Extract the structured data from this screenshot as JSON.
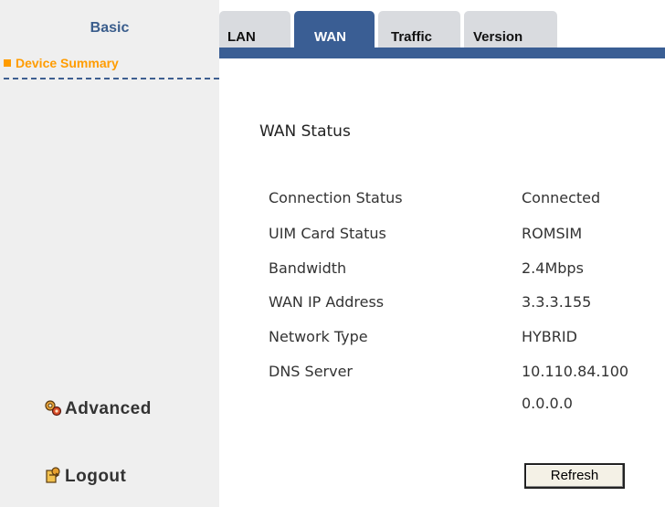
{
  "sidebar": {
    "basic_label": "Basic",
    "device_summary_label": "Device Summary",
    "advanced_label": "Advanced",
    "logout_label": "Logout",
    "accent_color": "#ff9c00",
    "icons": {
      "advanced": "gears-icon",
      "logout": "logout-icon"
    }
  },
  "tabs": [
    {
      "label": "LAN",
      "active": false
    },
    {
      "label": "WAN",
      "active": true
    },
    {
      "label": "Traffic",
      "active": false
    },
    {
      "label": "Version",
      "active": false
    }
  ],
  "theme": {
    "tab_active_color": "#3a5e94",
    "tab_inactive_color": "#d9dbdf"
  },
  "wan": {
    "title": "WAN Status",
    "rows": [
      {
        "label": "Connection Status",
        "value": "Connected"
      },
      {
        "label": "UIM Card Status",
        "value": "ROMSIM"
      },
      {
        "label": "Bandwidth",
        "value": "2.4Mbps"
      },
      {
        "label": "WAN IP Address",
        "value": "3.3.3.155"
      },
      {
        "label": "Network Type",
        "value": "HYBRID"
      },
      {
        "label": "DNS Server",
        "value": "10.110.84.100"
      },
      {
        "label": "",
        "value": "0.0.0.0"
      }
    ],
    "refresh_label": "Refresh"
  }
}
